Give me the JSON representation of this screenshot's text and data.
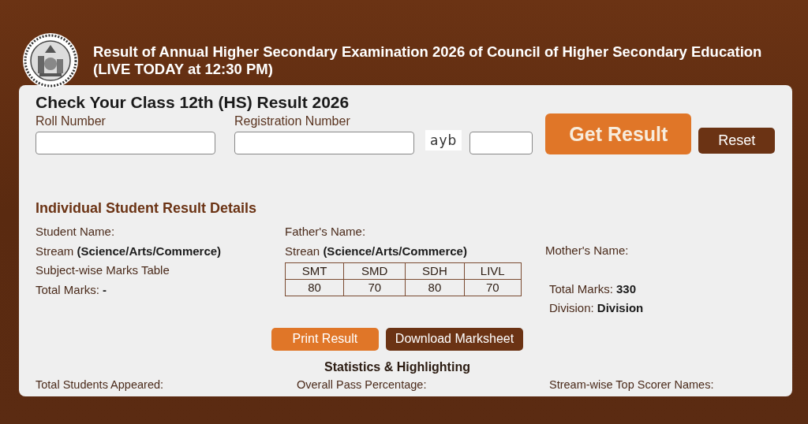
{
  "header": {
    "title_lines": [
      "Result of Annual Higher Secondary Examination 2026 of Council of Higher Secondary Education",
      "(LIVE TODAY at 12:30 PM)"
    ]
  },
  "form": {
    "heading": "Check Your Class 12th (HS) Result 2026",
    "fields": [
      {
        "label": "Roll Number"
      },
      {
        "label": "Registration Number"
      }
    ],
    "captcha": "ayb",
    "buttons": [
      {
        "label": "Get Result",
        "kind": "primary"
      },
      {
        "label": "Reset",
        "kind": "secondary"
      }
    ]
  },
  "details": {
    "heading": "Individual Student Result Details",
    "left": [
      "Student Name:",
      "Stream **(Science/Arts/Commerce)**",
      "Subject-wise Marks Table",
      "Total Marks: **-**"
    ],
    "middle": [
      "Father's Name:",
      "Strean **(Science/Arts/Commerce)**"
    ],
    "right": [
      "Mother's Name:",
      "Total Marks: **330**",
      "Division: **Division**"
    ],
    "marks_table": {
      "columns": [
        "SMT",
        "SMD",
        "SDH",
        "LIVL"
      ],
      "rows": [
        [
          "80",
          "70",
          "80",
          "70"
        ]
      ]
    },
    "actions": [
      {
        "label": "Print Result",
        "kind": "primary"
      },
      {
        "label": "Download Marksheet",
        "kind": "secondary"
      }
    ]
  },
  "statistics": {
    "heading": "Statistics & Highlighting",
    "items": [
      "Total Students Appeared:",
      "Overall Pass Percentage:",
      "Stream-wise Top Scorer Names:"
    ]
  }
}
